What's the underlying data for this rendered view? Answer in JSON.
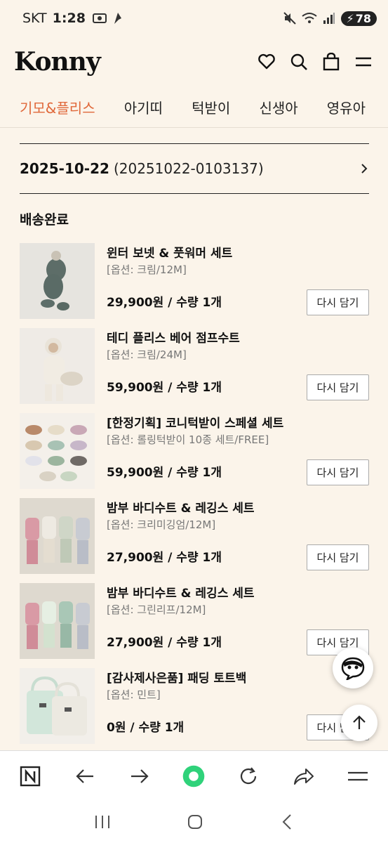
{
  "status_bar": {
    "carrier": "SKT",
    "time": "1:28",
    "battery": "78"
  },
  "header": {
    "logo": "Konny"
  },
  "tabs": [
    {
      "label": "기모&플리스",
      "active": true
    },
    {
      "label": "아기띠",
      "active": false
    },
    {
      "label": "턱받이",
      "active": false
    },
    {
      "label": "신생아",
      "active": false
    },
    {
      "label": "영유아",
      "active": false
    }
  ],
  "order": {
    "date": "2025-10-22",
    "number": "(20251022-0103137)"
  },
  "status_title": "배송완료",
  "products": [
    {
      "name": "윈터 보넷 & 풋워머 세트",
      "option": "[옵션: 크림/12M]",
      "price_qty": "29,900원 / 수량 1개",
      "button": "다시 담기"
    },
    {
      "name": "테디 플리스 베어 점프수트",
      "option": "[옵션: 크림/24M]",
      "price_qty": "59,900원 / 수량 1개",
      "button": "다시 담기"
    },
    {
      "name": "[한정기획] 코니턱받이 스페셜 세트",
      "option": "[옵션: 롤링턱받이 10종 세트/FREE]",
      "price_qty": "59,900원 / 수량 1개",
      "button": "다시 담기"
    },
    {
      "name": "밤부 바디수트 & 레깅스 세트",
      "option": "[옵션: 크리미깅엄/12M]",
      "price_qty": "27,900원 / 수량 1개",
      "button": "다시 담기"
    },
    {
      "name": "밤부 바디수트 & 레깅스 세트",
      "option": "[옵션: 그린리프/12M]",
      "price_qty": "27,900원 / 수량 1개",
      "button": "다시 담기"
    },
    {
      "name": "[감사제사은품] 패딩 토트백",
      "option": "[옵션: 민트]",
      "price_qty": "0원 / 수량 1개",
      "button": "다시 담기"
    }
  ],
  "colors": {
    "accent": "#e0683a",
    "background": "#fbf4ea"
  }
}
